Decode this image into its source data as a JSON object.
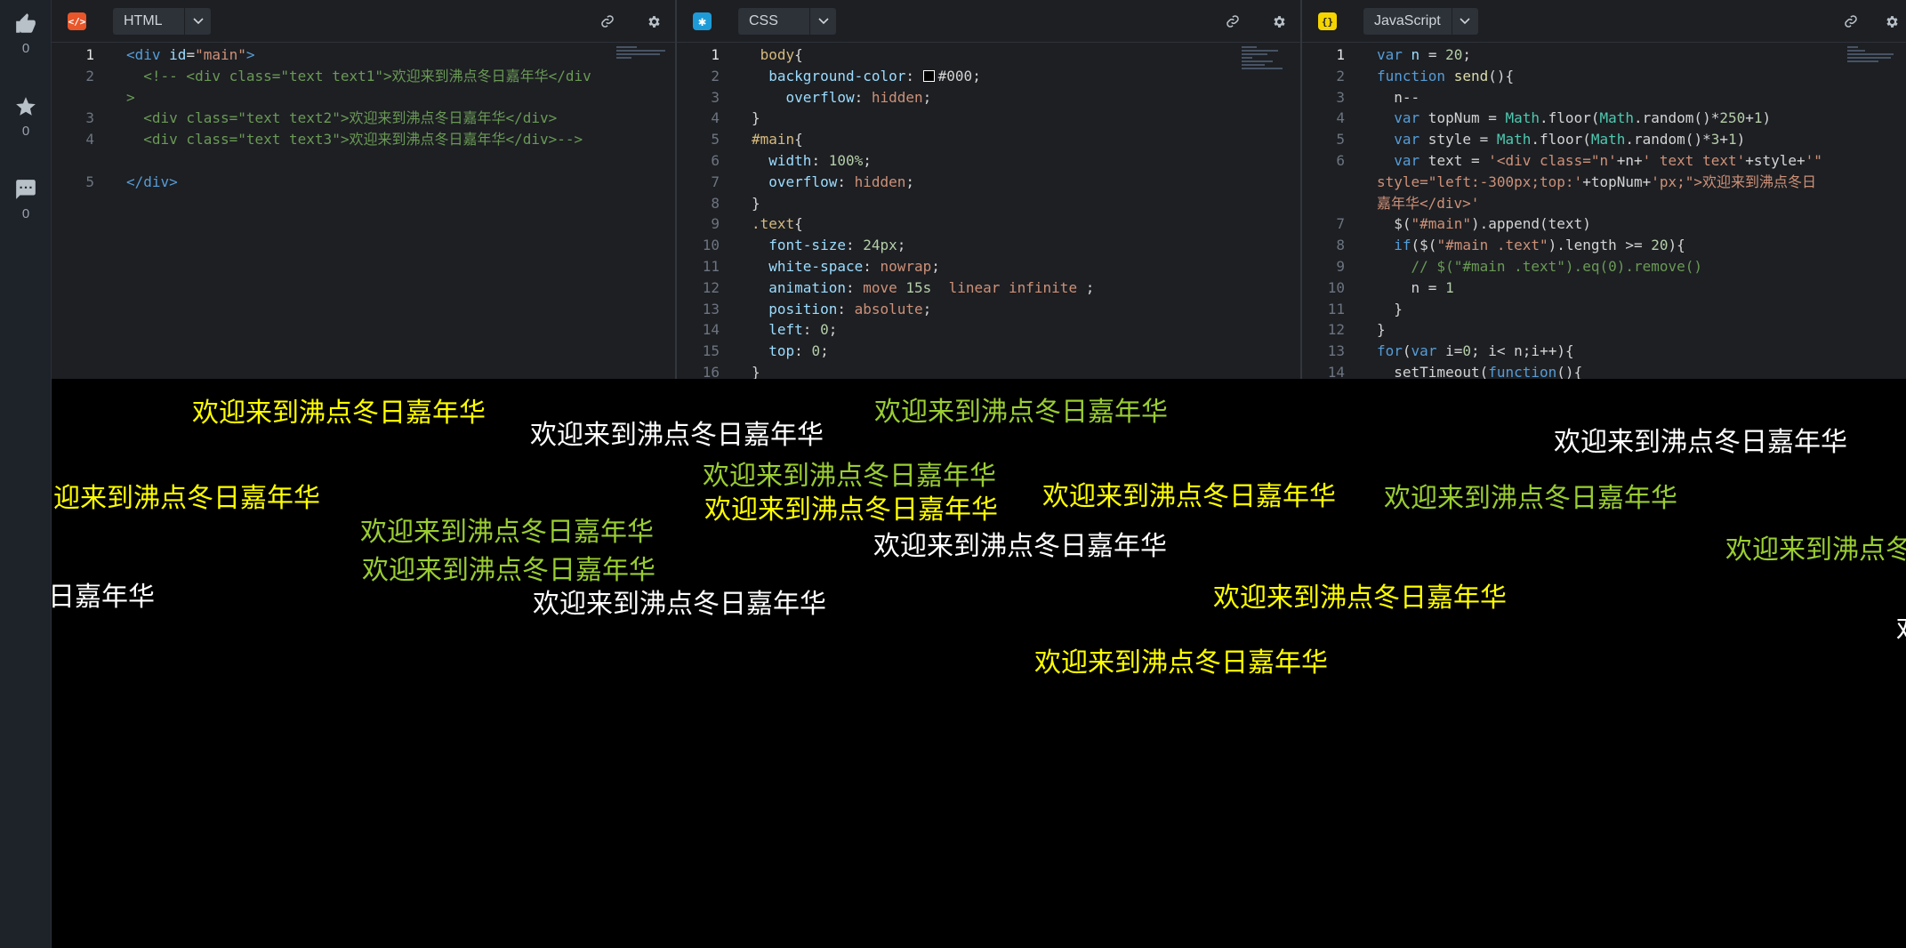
{
  "sidebar": {
    "like_count": "0",
    "star_count": "0",
    "comment_count": "0"
  },
  "panes": {
    "html": {
      "lang": "HTML",
      "icon": "html-icon",
      "accent": "#e8562a"
    },
    "css": {
      "lang": "CSS",
      "icon": "css-icon",
      "accent": "#1e9bd7"
    },
    "js": {
      "lang": "JavaScript",
      "icon": "js-icon",
      "accent": "#f5d400"
    }
  },
  "code": {
    "html": [
      {
        "n": "1",
        "t": "<div id=\"main\">"
      },
      {
        "n": "2",
        "t": "  <!-- <div class=\"text text1\">欢迎来到沸点冬日嘉年华</div>"
      },
      {
        "n": "3",
        "t": "  <div class=\"text text2\">欢迎来到沸点冬日嘉年华</div>"
      },
      {
        "n": "4",
        "t": "  <div class=\"text text3\">欢迎来到沸点冬日嘉年华</div>-->"
      },
      {
        "n": "5",
        "t": "</div>"
      }
    ],
    "css": [
      {
        "n": "1",
        "t": " body{"
      },
      {
        "n": "2",
        "t": "  background-color: #000;"
      },
      {
        "n": "3",
        "t": "    overflow: hidden;"
      },
      {
        "n": "4",
        "t": "}"
      },
      {
        "n": "5",
        "t": "#main{"
      },
      {
        "n": "6",
        "t": "  width: 100%;"
      },
      {
        "n": "7",
        "t": "  overflow: hidden;"
      },
      {
        "n": "8",
        "t": "}"
      },
      {
        "n": "9",
        "t": ".text{"
      },
      {
        "n": "10",
        "t": "  font-size: 24px;"
      },
      {
        "n": "11",
        "t": "  white-space: nowrap;"
      },
      {
        "n": "12",
        "t": "  animation: move 15s  linear infinite ;"
      },
      {
        "n": "13",
        "t": "  position: absolute;"
      },
      {
        "n": "14",
        "t": "  left: 0;"
      },
      {
        "n": "15",
        "t": "  top: 0;"
      },
      {
        "n": "16",
        "t": "}"
      }
    ],
    "js": [
      {
        "n": "1",
        "t": "var n = 20;"
      },
      {
        "n": "2",
        "t": "function send(){"
      },
      {
        "n": "3",
        "t": "  n--"
      },
      {
        "n": "4",
        "t": "  var topNum = Math.floor(Math.random()*250+1)"
      },
      {
        "n": "5",
        "t": "  var style = Math.floor(Math.random()*3+1)"
      },
      {
        "n": "6",
        "t": "  var text = '<div class=\"n'+n+' text text'+style+'\" style=\"left:-300px;top:'+topNum+'px;\">欢迎来到沸点冬日嘉年华</div>'"
      },
      {
        "n": "7",
        "t": "  $(\"#main\").append(text)"
      },
      {
        "n": "8",
        "t": "  if($(\"#main .text\").length >= 20){"
      },
      {
        "n": "9",
        "t": "    // $(\"#main .text\").eq(0).remove()"
      },
      {
        "n": "10",
        "t": "    n = 1"
      },
      {
        "n": "11",
        "t": "  }"
      },
      {
        "n": "12",
        "t": "}"
      },
      {
        "n": "13",
        "t": "for(var i=0; i< n;i++){"
      },
      {
        "n": "14",
        "t": "  setTimeout(function(){"
      }
    ]
  },
  "preview": {
    "message": "欢迎来到沸点冬日嘉年华",
    "colors": {
      "yellow": "#ffff00",
      "green": "#9acd32",
      "white": "#ffffff"
    },
    "items": [
      {
        "text": "欢迎来到沸点冬日嘉年华",
        "color": "yellow"
      },
      {
        "text": "欢迎来到沸点冬日嘉年华",
        "color": "white"
      },
      {
        "text": "欢迎来到沸点冬日嘉年华",
        "color": "green"
      },
      {
        "text": "欢迎来到沸点冬日嘉年华",
        "color": "white"
      },
      {
        "text": "迎来到沸点冬日嘉年华",
        "color": "yellow"
      },
      {
        "text": "欢迎来到沸点冬日嘉年华",
        "color": "green"
      },
      {
        "text": "欢迎来到沸点冬日嘉年华",
        "color": "yellow"
      },
      {
        "text": "欢迎来到沸点冬日嘉年华",
        "color": "yellow"
      },
      {
        "text": "欢迎来到沸点冬日嘉年华",
        "color": "green"
      },
      {
        "text": "欢迎来到沸点冬日嘉年华",
        "color": "green"
      },
      {
        "text": "欢迎来到沸点冬日嘉年华",
        "color": "green"
      },
      {
        "text": "欢迎来到沸点冬日嘉年华",
        "color": "white"
      },
      {
        "text": "欢迎来到沸点冬",
        "color": "green"
      },
      {
        "text": "日嘉年华",
        "color": "white"
      },
      {
        "text": "欢迎来到沸点冬日嘉年华",
        "color": "white"
      },
      {
        "text": "欢迎来到沸点冬日嘉年华",
        "color": "yellow"
      },
      {
        "text": "欢",
        "color": "white"
      },
      {
        "text": "欢迎来到沸点冬日嘉年华",
        "color": "yellow"
      }
    ]
  }
}
